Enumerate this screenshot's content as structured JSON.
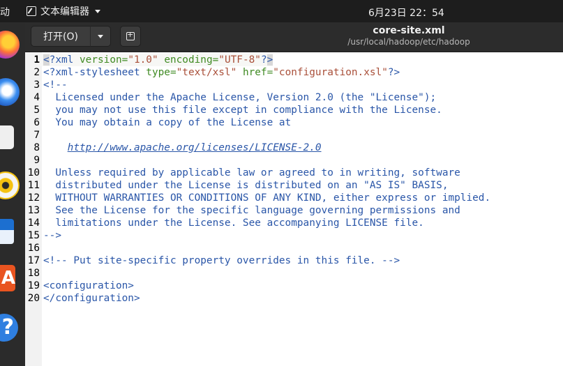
{
  "topbar": {
    "activities_cut": "动",
    "app_name": "文本编辑器",
    "clock": "6月23日  22：54"
  },
  "dock": {
    "items": [
      "firefox-icon",
      "thunderbird-icon",
      "files-icon",
      "rhythmbox-icon",
      "writer-icon",
      "software-icon",
      "help-icon"
    ],
    "software_glyph": "A",
    "help_glyph": "?"
  },
  "headerbar": {
    "open_label": "打开(O)",
    "title": "core-site.xml",
    "path": "/usr/local/hadoop/etc/hadoop"
  },
  "editor": {
    "line_numbers": [
      "1",
      "2",
      "3",
      "4",
      "5",
      "6",
      "7",
      "8",
      "9",
      "10",
      "11",
      "12",
      "13",
      "14",
      "15",
      "16",
      "17",
      "18",
      "19",
      "20"
    ],
    "current_line": 1,
    "lines": {
      "l1": {
        "lt": "<",
        "pi_open": "?xml ",
        "attr1": "version=",
        "val1": "\"1.0\"",
        "attr2": "encoding=",
        "val2": "\"UTF-8\"",
        "pi_close": "?",
        "gt": ">"
      },
      "l2": {
        "open": "<?xml-stylesheet ",
        "attr1": "type=",
        "val1": "\"text/xsl\"",
        "attr2": "href=",
        "val2": "\"configuration.xsl\"",
        "close": "?>"
      },
      "l3": "<!--",
      "l4": "  Licensed under the Apache License, Version 2.0 (the \"License\");",
      "l5": "  you may not use this file except in compliance with the License.",
      "l6": "  You may obtain a copy of the License at",
      "l7": "",
      "l8_indent": "    ",
      "l8_link": "http://www.apache.org/licenses/LICENSE-2.0",
      "l9": "",
      "l10": "  Unless required by applicable law or agreed to in writing, software",
      "l11": "  distributed under the License is distributed on an \"AS IS\" BASIS,",
      "l12": "  WITHOUT WARRANTIES OR CONDITIONS OF ANY KIND, either express or implied.",
      "l13": "  See the License for the specific language governing permissions and",
      "l14": "  limitations under the License. See accompanying LICENSE file.",
      "l15": "-->",
      "l16": "",
      "l17": "<!-- Put site-specific property overrides in this file. -->",
      "l18": "",
      "l19": "<configuration>",
      "l20": "</configuration>"
    }
  },
  "colors": {
    "topbar": "#1d1d1d",
    "headerbar": "#2c2c2c",
    "dock": "#2b2b2b",
    "xml_blue": "#2a56a8",
    "xml_attr_green": "#3f8a22",
    "xml_string": "#a94f39"
  }
}
